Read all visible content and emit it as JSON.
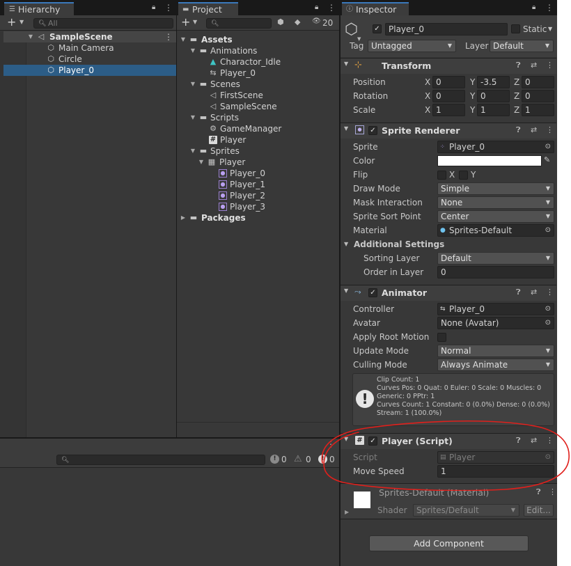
{
  "hierarchy": {
    "tab": "Hierarchy",
    "search_placeholder": "All",
    "scene": "SampleScene",
    "items": [
      {
        "label": "Main Camera",
        "selected": false
      },
      {
        "label": "Circle",
        "selected": false
      },
      {
        "label": "Player_0",
        "selected": true
      }
    ]
  },
  "project": {
    "tab": "Project",
    "hidden_count": "20",
    "tree": {
      "assets": "Assets",
      "animations": "Animations",
      "charactor_idle": "Charactor_Idle",
      "player_0_anim": "Player_0",
      "scenes": "Scenes",
      "first_scene": "FirstScene",
      "sample_scene": "SampleScene",
      "scripts": "Scripts",
      "game_manager": "GameManager",
      "player_script": "Player",
      "sprites": "Sprites",
      "player_sheet": "Player",
      "player_0": "Player_0",
      "player_1": "Player_1",
      "player_2": "Player_2",
      "player_3": "Player_3",
      "packages": "Packages"
    }
  },
  "console": {
    "counts": {
      "logs": "0",
      "warnings": "0",
      "errors": "0"
    }
  },
  "inspector": {
    "tab": "Inspector",
    "object_name": "Player_0",
    "static_label": "Static",
    "tag_label": "Tag",
    "tag_value": "Untagged",
    "layer_label": "Layer",
    "layer_value": "Default",
    "transform": {
      "title": "Transform",
      "position_label": "Position",
      "rotation_label": "Rotation",
      "scale_label": "Scale",
      "axis": {
        "x": "X",
        "y": "Y",
        "z": "Z"
      },
      "position": {
        "x": "0",
        "y": "-3.5",
        "z": "0"
      },
      "rotation": {
        "x": "0",
        "y": "0",
        "z": "0"
      },
      "scale": {
        "x": "1",
        "y": "1",
        "z": "1"
      }
    },
    "sprite_renderer": {
      "title": "Sprite Renderer",
      "sprite_label": "Sprite",
      "sprite_value": "Player_0",
      "color_label": "Color",
      "color_value": "#ffffff",
      "flip_label": "Flip",
      "flip_x": "X",
      "flip_y": "Y",
      "draw_mode_label": "Draw Mode",
      "draw_mode_value": "Simple",
      "mask_label": "Mask Interaction",
      "mask_value": "None",
      "sort_point_label": "Sprite Sort Point",
      "sort_point_value": "Center",
      "material_label": "Material",
      "material_value": "Sprites-Default",
      "additional_label": "Additional Settings",
      "sorting_layer_label": "Sorting Layer",
      "sorting_layer_value": "Default",
      "order_label": "Order in Layer",
      "order_value": "0"
    },
    "animator": {
      "title": "Animator",
      "controller_label": "Controller",
      "controller_value": "Player_0",
      "avatar_label": "Avatar",
      "avatar_value": "None (Avatar)",
      "root_motion_label": "Apply Root Motion",
      "update_label": "Update Mode",
      "update_value": "Normal",
      "culling_label": "Culling Mode",
      "culling_value": "Always Animate",
      "info": [
        "Clip Count: 1",
        "Curves Pos: 0 Quat: 0 Euler: 0 Scale: 0 Muscles: 0",
        "Generic: 0 PPtr: 1",
        "Curves Count: 1 Constant: 0 (0.0%) Dense: 0 (0.0%)",
        "Stream: 1 (100.0%)"
      ]
    },
    "player_script": {
      "title": "Player (Script)",
      "script_label": "Script",
      "script_value": "Player",
      "move_speed_label": "Move Speed",
      "move_speed_value": "1"
    },
    "material": {
      "name": "Sprites-Default (Material)",
      "shader_label": "Shader",
      "shader_value": "Sprites/Default",
      "edit_label": "Edit..."
    },
    "add_component_label": "Add Component"
  },
  "annotation": {
    "color": "#e0201c"
  }
}
